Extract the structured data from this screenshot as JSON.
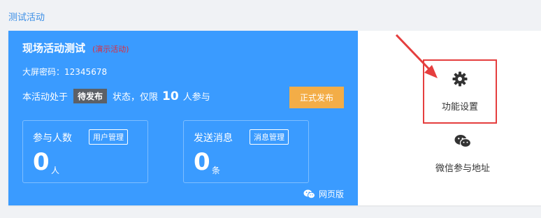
{
  "breadcrumb": {
    "text": "测试活动"
  },
  "event": {
    "title": "现场活动测试",
    "demo_tag": "(演示活动)",
    "password_label": "大屏密码：",
    "password": "12345678",
    "status_prefix": "本活动处于",
    "status": "待发布",
    "status_mid": "状态，仅限",
    "limit": "10",
    "status_suffix": "人参与",
    "publish_label": "正式发布"
  },
  "stats": [
    {
      "label": "参与人数",
      "button": "用户管理",
      "value": "0",
      "unit": "人"
    },
    {
      "label": "发送消息",
      "button": "消息管理",
      "value": "0",
      "unit": "条"
    }
  ],
  "web_link": {
    "label": "网页版",
    "icon": "wechat-icon"
  },
  "actions": {
    "settings": {
      "label": "功能设置",
      "icon": "gear-icon"
    },
    "wechat": {
      "label": "微信参与地址",
      "icon": "wechat-icon"
    }
  },
  "colors": {
    "panel_blue": "#3a9bff",
    "publish_orange": "#f3ad47",
    "highlight_red": "#e53e3e",
    "demo_red": "#e12c3a"
  }
}
